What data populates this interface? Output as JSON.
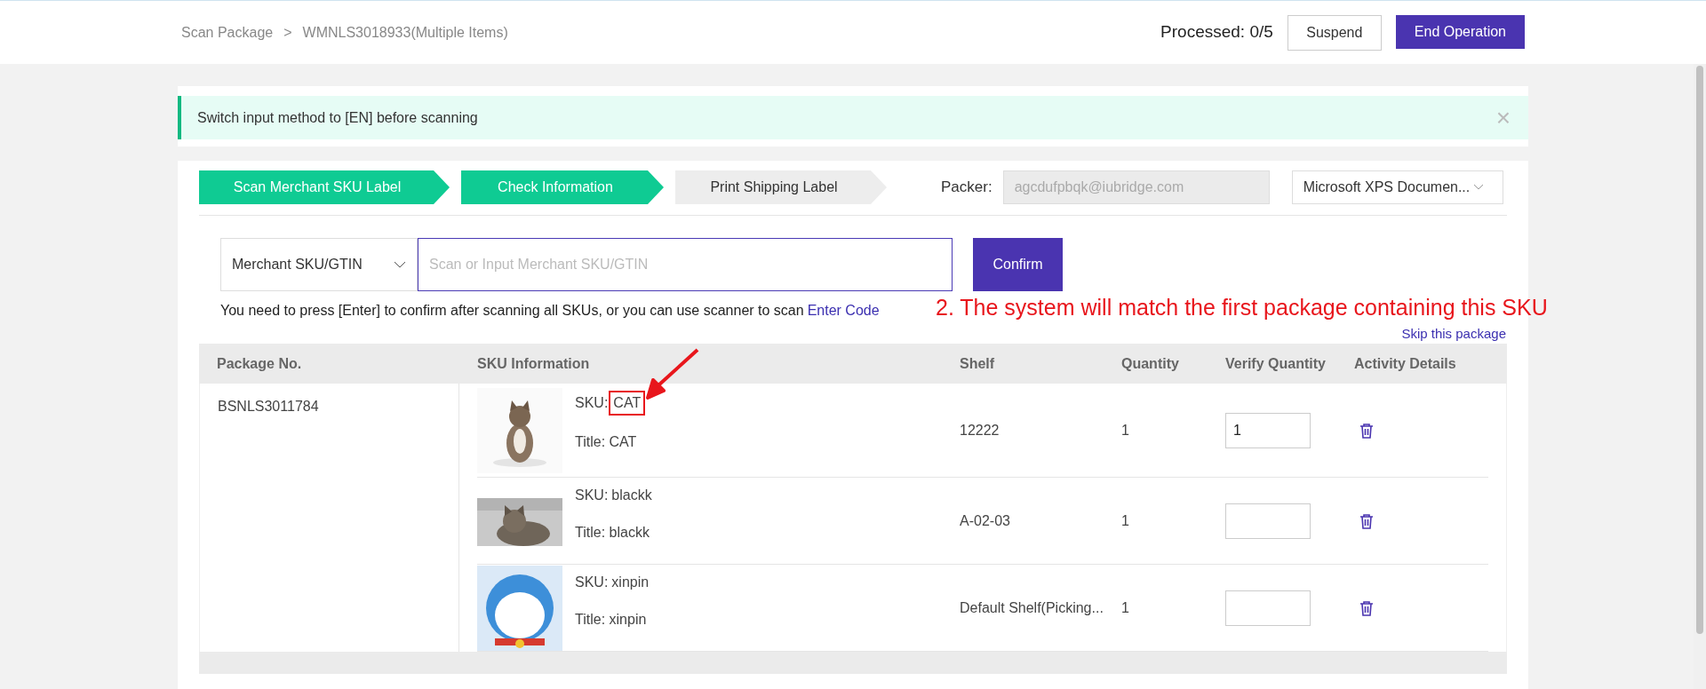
{
  "breadcrumb": [
    "Scan Package",
    "WMNLS3018933(Multiple Items)"
  ],
  "breadcrumb_separator": ">",
  "processed": "Processed: 0/5",
  "header_buttons": [
    {
      "label": "Suspend",
      "kind": "secondary"
    },
    {
      "label": "End Operation",
      "kind": "primary"
    }
  ],
  "notice": {
    "text": "Switch input method to [EN] before scanning",
    "close": "×"
  },
  "steps": [
    {
      "label": "Scan Merchant SKU Label",
      "selected": true
    },
    {
      "label": "Check Information",
      "selected": true
    },
    {
      "label": "Print Shipping Label",
      "selected": false
    }
  ],
  "packer": {
    "label": "Packer:",
    "value": "agcdufpbqk@iubridge.com"
  },
  "printer": {
    "value": "Microsoft XPS Documen..."
  },
  "scan": {
    "type": "Merchant SKU/GTIN",
    "placeholder": "Scan or Input Merchant SKU/GTIN",
    "button": "Confirm"
  },
  "hint": {
    "text": "You need to press [Enter] to confirm after scanning all SKUs, or you can use scanner to scan",
    "link": "Enter Code"
  },
  "annotation": "2. The system will match the first package containing this SKU",
  "skip_link": "Skip this package",
  "table": {
    "columns": [
      "Package No.",
      "SKU Information",
      "Shelf",
      "Quantity",
      "Verify Quantity",
      "Activity Details"
    ],
    "package_no": "BSNLS3011784",
    "rows": [
      {
        "sku_label": "SKU:",
        "sku": "CAT",
        "title": "Title: CAT",
        "shelf": "12222",
        "quantity": "1",
        "verify_quantity": "1",
        "highlighted": true
      },
      {
        "sku_label": "SKU:",
        "sku": "blackk",
        "title": "Title: blackk",
        "shelf": "A-02-03",
        "quantity": "1",
        "highlighted": false
      },
      {
        "sku_label": "SKU:",
        "sku": "xinpin",
        "title": "Title: xinpin",
        "shelf": "Default Shelf(Picking...",
        "quantity": "1",
        "highlighted": false
      }
    ]
  }
}
